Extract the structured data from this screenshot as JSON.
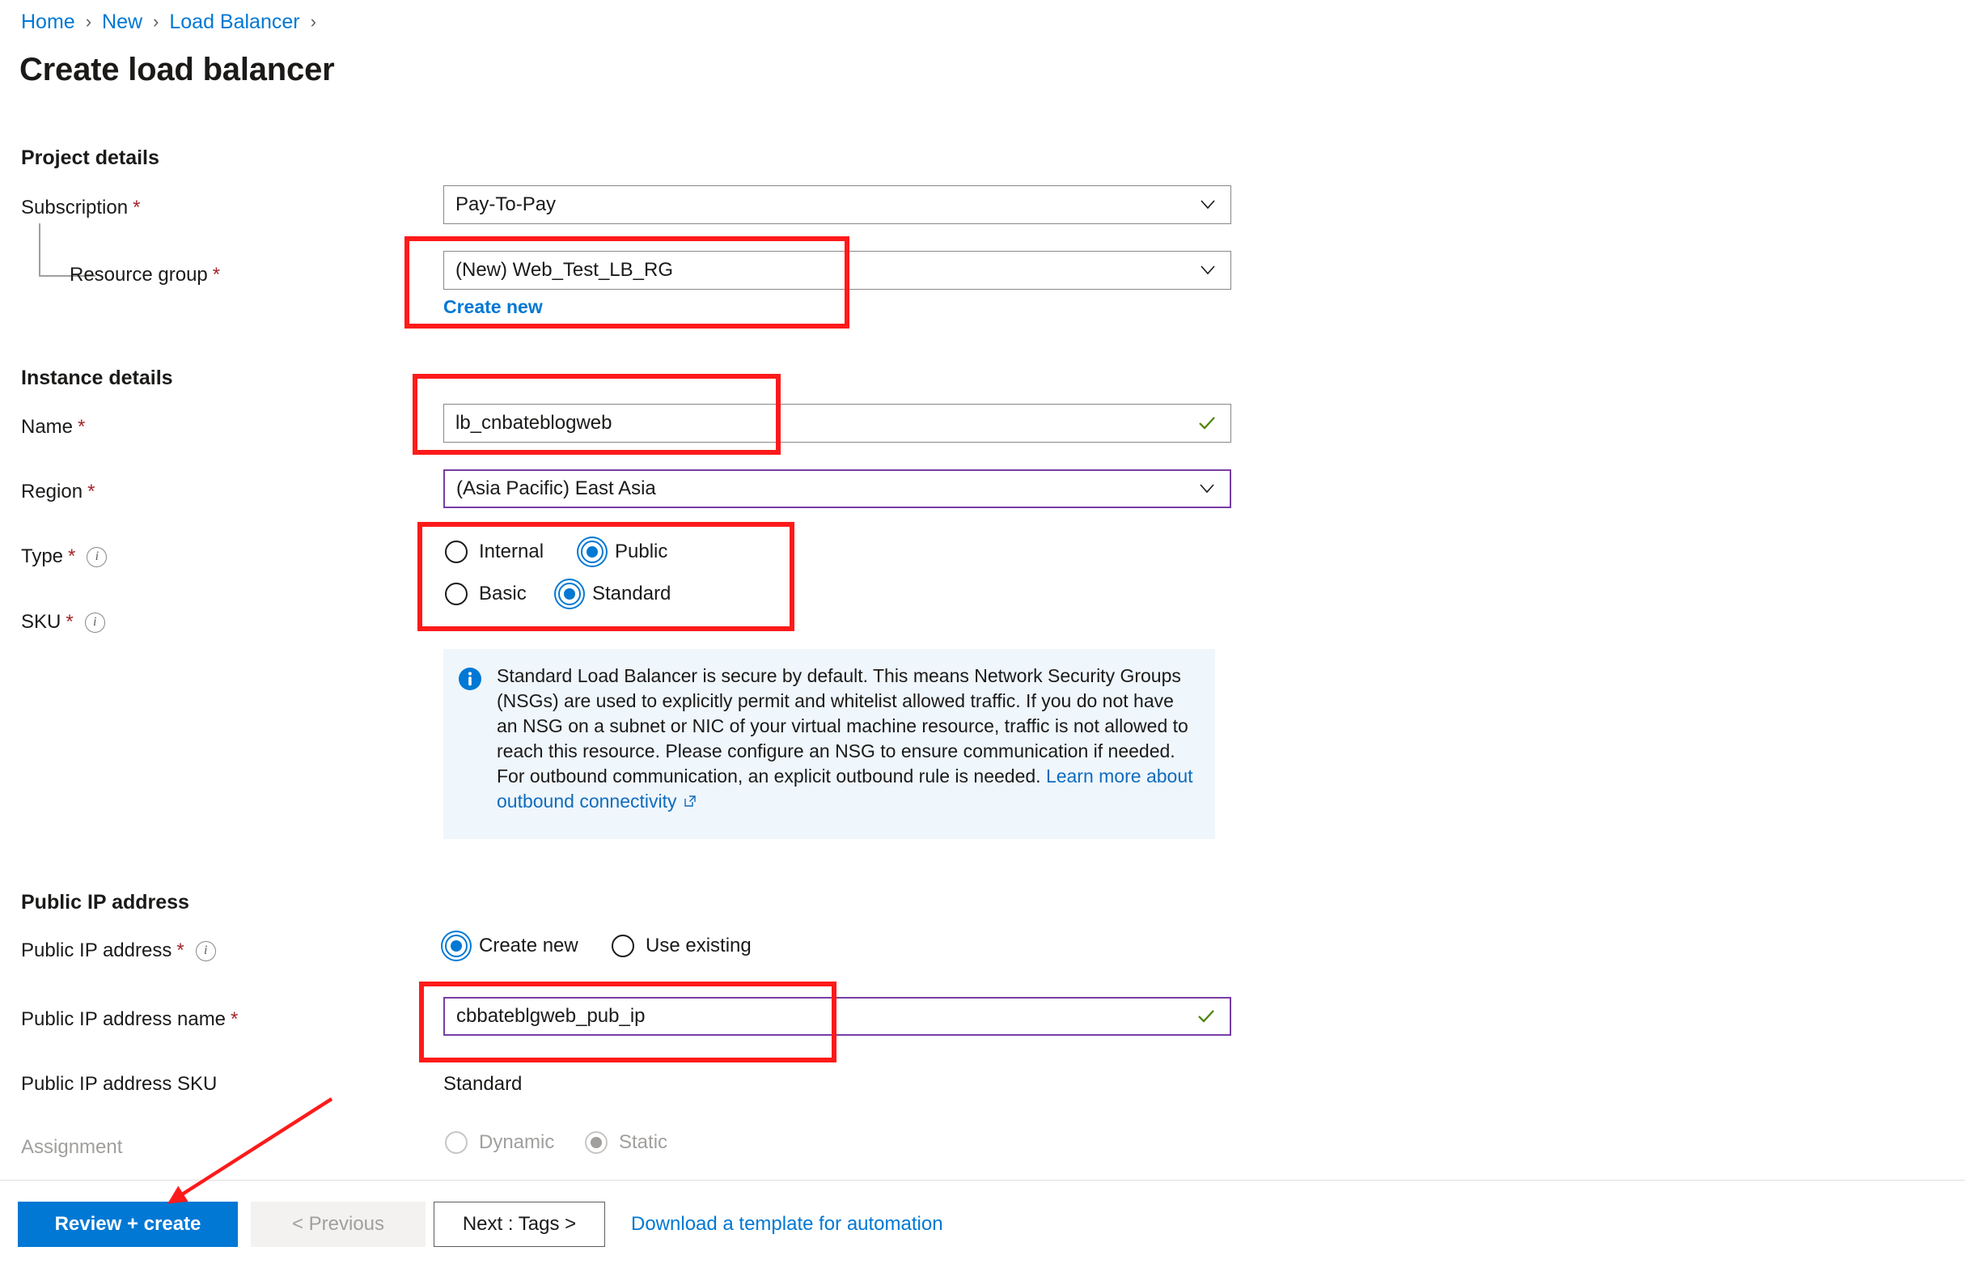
{
  "breadcrumb": {
    "items": [
      {
        "label": "Home"
      },
      {
        "label": "New"
      },
      {
        "label": "Load Balancer"
      }
    ],
    "separator": "›"
  },
  "page": {
    "title": "Create load balancer"
  },
  "sections": {
    "project_details": {
      "heading": "Project details",
      "subscription": {
        "label": "Subscription",
        "required_mark": "*",
        "value": "Pay-To-Pay",
        "chevron_icon": "chevron-down-icon"
      },
      "resource_group": {
        "label": "Resource group",
        "required_mark": "*",
        "value": "(New) Web_Test_LB_RG",
        "create_new_link": "Create new",
        "chevron_icon": "chevron-down-icon"
      }
    },
    "instance_details": {
      "heading": "Instance details",
      "name": {
        "label": "Name",
        "required_mark": "*",
        "value": "lb_cnbateblogweb",
        "validation_icon": "green-check-icon"
      },
      "region": {
        "label": "Region",
        "required_mark": "*",
        "value": "(Asia Pacific) East Asia",
        "chevron_icon": "chevron-down-icon"
      },
      "type": {
        "label": "Type",
        "required_mark": "*",
        "info_icon": "info-circle-icon",
        "options": [
          {
            "label": "Internal",
            "selected": false
          },
          {
            "label": "Public",
            "selected": true
          }
        ]
      },
      "sku": {
        "label": "SKU",
        "required_mark": "*",
        "info_icon": "info-circle-icon",
        "options": [
          {
            "label": "Basic",
            "selected": false
          },
          {
            "label": "Standard",
            "selected": true
          }
        ]
      },
      "info_banner": {
        "icon": "info-filled-icon",
        "text": "Standard Load Balancer is secure by default.  This means Network Security Groups (NSGs) are used to explicitly permit and whitelist allowed traffic. If you do not have an NSG on a subnet or NIC of your virtual machine resource, traffic is not allowed to reach this resource. Please configure an NSG to ensure communication if needed.  For outbound communication, an explicit outbound rule is needed. ",
        "link_text": "Learn more about outbound connectivity",
        "link_external_icon": "external-link-icon"
      }
    },
    "public_ip_address": {
      "heading": "Public IP address",
      "public_ip": {
        "label": "Public IP address",
        "required_mark": "*",
        "info_icon": "info-circle-icon",
        "options": [
          {
            "label": "Create new",
            "selected": true
          },
          {
            "label": "Use existing",
            "selected": false
          }
        ]
      },
      "public_ip_name": {
        "label": "Public IP address name",
        "required_mark": "*",
        "value": "cbbateblgweb_pub_ip",
        "validation_icon": "green-check-icon"
      },
      "public_ip_sku": {
        "label": "Public IP address SKU",
        "value": "Standard"
      },
      "assignment": {
        "label": "Assignment",
        "disabled": true,
        "options": [
          {
            "label": "Dynamic",
            "selected": false
          },
          {
            "label": "Static",
            "selected": true
          }
        ]
      }
    }
  },
  "command_bar": {
    "review_create": "Review + create",
    "previous": "< Previous",
    "next": "Next : Tags >",
    "download_template": "Download a template for automation"
  },
  "annotations": {
    "accent_color": "#ff1a1a",
    "arrow_target": "Review + create"
  },
  "colors": {
    "link": "#0078d4",
    "primary_button": "#0078d4",
    "required_star": "#a4262c",
    "focus_border": "#773ea5",
    "banner_bg": "#eff6fc",
    "success_check": "#498205",
    "annotation_red": "#ff1a1a"
  }
}
